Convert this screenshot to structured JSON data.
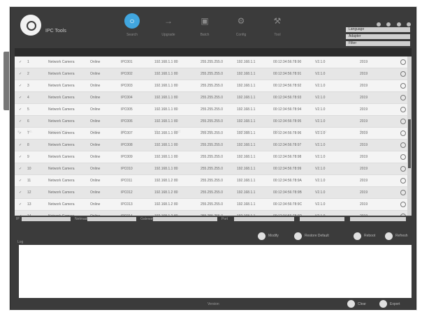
{
  "header": {
    "title": "IPC Tools",
    "nav": [
      {
        "label": "Search",
        "icon": "search-icon",
        "active": true
      },
      {
        "label": "Upgrade",
        "icon": "arrow-icon",
        "active": false
      },
      {
        "label": "Batch",
        "icon": "batch-icon",
        "active": false
      },
      {
        "label": "Config",
        "icon": "config-icon",
        "active": false
      },
      {
        "label": "Tool",
        "icon": "tool-icon",
        "active": false
      }
    ],
    "fields": [
      "Language",
      "Adapter",
      "Filter"
    ]
  },
  "table": {
    "columns": [
      "No.",
      "Device Type",
      "Status",
      "SN",
      "IP",
      "Port",
      "Subnet",
      "Gateway",
      "MAC",
      "Version",
      "Build"
    ],
    "rows": [
      [
        "1",
        "Network Camera",
        "Online",
        "IPC001",
        "192.168.1.10",
        "80",
        "255.255.255.0",
        "192.168.1.1",
        "00:12:34:56:78:90",
        "V2.1.0",
        "2019"
      ],
      [
        "2",
        "Network Camera",
        "Online",
        "IPC002",
        "192.168.1.11",
        "80",
        "255.255.255.0",
        "192.168.1.1",
        "00:12:34:56:78:91",
        "V2.1.0",
        "2019"
      ],
      [
        "3",
        "Network Camera",
        "Online",
        "IPC003",
        "192.168.1.12",
        "80",
        "255.255.255.0",
        "192.168.1.1",
        "00:12:34:56:78:92",
        "V2.1.0",
        "2019"
      ],
      [
        "4",
        "Network Camera",
        "Online",
        "IPC004",
        "192.168.1.13",
        "80",
        "255.255.255.0",
        "192.168.1.1",
        "00:12:34:56:78:93",
        "V2.1.0",
        "2019"
      ],
      [
        "5",
        "Network Camera",
        "Online",
        "IPC005",
        "192.168.1.14",
        "80",
        "255.255.255.0",
        "192.168.1.1",
        "00:12:34:56:78:94",
        "V2.1.0",
        "2019"
      ],
      [
        "6",
        "Network Camera",
        "Online",
        "IPC006",
        "192.168.1.15",
        "80",
        "255.255.255.0",
        "192.168.1.1",
        "00:12:34:56:78:95",
        "V2.1.0",
        "2019"
      ],
      [
        "7",
        "Network Camera",
        "Online",
        "IPC007",
        "192.168.1.16",
        "80",
        "255.255.255.0",
        "192.168.1.1",
        "00:12:34:56:78:96",
        "V2.1.0",
        "2019"
      ],
      [
        "8",
        "Network Camera",
        "Online",
        "IPC008",
        "192.168.1.17",
        "80",
        "255.255.255.0",
        "192.168.1.1",
        "00:12:34:56:78:97",
        "V2.1.0",
        "2019"
      ],
      [
        "9",
        "Network Camera",
        "Online",
        "IPC009",
        "192.168.1.18",
        "80",
        "255.255.255.0",
        "192.168.1.1",
        "00:12:34:56:78:98",
        "V2.1.0",
        "2019"
      ],
      [
        "10",
        "Network Camera",
        "Online",
        "IPC010",
        "192.168.1.19",
        "80",
        "255.255.255.0",
        "192.168.1.1",
        "00:12:34:56:78:99",
        "V2.1.0",
        "2019"
      ],
      [
        "11",
        "Network Camera",
        "Online",
        "IPC011",
        "192.168.1.20",
        "80",
        "255.255.255.0",
        "192.168.1.1",
        "00:12:34:56:78:9A",
        "V2.1.0",
        "2019"
      ],
      [
        "12",
        "Network Camera",
        "Online",
        "IPC012",
        "192.168.1.21",
        "80",
        "255.255.255.0",
        "192.168.1.1",
        "00:12:34:56:78:9B",
        "V2.1.0",
        "2019"
      ],
      [
        "13",
        "Network Camera",
        "Online",
        "IPC013",
        "192.168.1.22",
        "80",
        "255.255.255.0",
        "192.168.1.1",
        "00:12:34:56:78:9C",
        "V2.1.0",
        "2019"
      ],
      [
        "14",
        "Network Camera",
        "Online",
        "IPC014",
        "192.168.1.23",
        "80",
        "255.255.255.0",
        "192.168.1.1",
        "00:12:34:56:78:9D",
        "V2.1.0",
        "2019"
      ]
    ]
  },
  "toolbar": {
    "labels": [
      "IP",
      "Netmask",
      "Gateway",
      "Port"
    ],
    "buttons": [
      "Modify",
      "Restore Default",
      "Reboot",
      "Refresh"
    ]
  },
  "log": {
    "label": "Log"
  },
  "footer": {
    "note": "Version",
    "buttons": [
      "Clear",
      "Export"
    ]
  }
}
